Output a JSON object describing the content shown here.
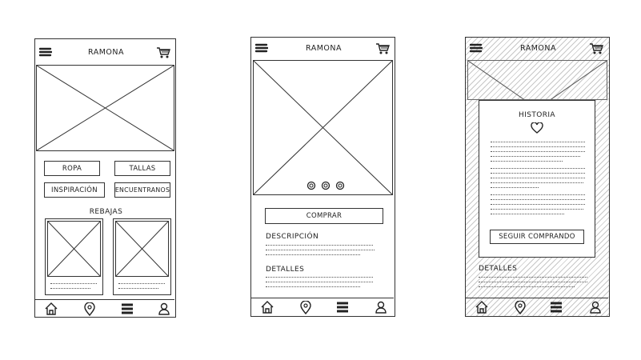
{
  "screen1": {
    "header": {
      "title": "RAMONA",
      "menu_icon": "hamburger-icon",
      "cart_icon": "cart-icon"
    },
    "categories": [
      "ROPA",
      "TALLAS",
      "INSPIRACIÓN",
      "ENCUENTRANOS"
    ],
    "section_title": "REBAJAS",
    "bottom_nav": [
      "home-icon",
      "location-pin-icon",
      "list-icon",
      "user-icon"
    ]
  },
  "screen2": {
    "header": {
      "title": "RAMONA",
      "menu_icon": "hamburger-icon",
      "cart_icon": "cart-icon"
    },
    "buy_button": "COMPRAR",
    "description_label": "DESCRIPCIÓN",
    "details_label": "DETALLES",
    "bottom_nav": [
      "home-icon",
      "location-pin-icon",
      "list-icon",
      "user-icon"
    ]
  },
  "screen3": {
    "header": {
      "title": "RAMONA",
      "menu_icon": "hamburger-icon",
      "cart_icon": "cart-icon"
    },
    "modal_title": "HISTORIA",
    "modal_icon": "heart-icon",
    "continue_button": "SEGUIR COMPRANDO",
    "details_label": "DETALLES",
    "bottom_nav": [
      "home-icon",
      "location-pin-icon",
      "list-icon",
      "user-icon"
    ]
  }
}
